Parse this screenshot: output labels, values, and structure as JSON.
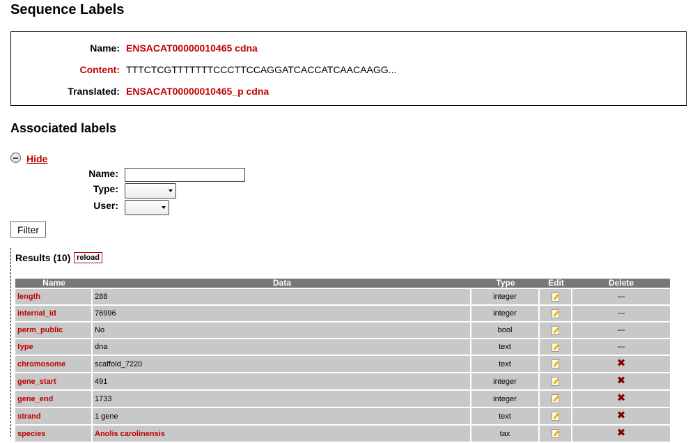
{
  "page_title": "Sequence Labels",
  "sequence": {
    "name_label": "Name:",
    "name_value": "ENSACAT00000010465 cdna",
    "content_label": "Content:",
    "content_value": "TTTCTCGTTTTTTTCCCTTCCAGGATCACCATCAACAAGG...",
    "translated_label": "Translated:",
    "translated_value": "ENSACAT00000010465_p cdna"
  },
  "associated_title": "Associated labels",
  "toggle_link": "Hide",
  "filter": {
    "name_label": "Name:",
    "name_value": "",
    "type_label": "Type:",
    "type_value": "",
    "user_label": "User:",
    "user_value": "",
    "button": "Filter"
  },
  "results": {
    "title": "Results (10)",
    "reload": "reload",
    "columns": [
      "Name",
      "Data",
      "Type",
      "Edit",
      "Delete"
    ],
    "rows": [
      {
        "name": "length",
        "data": "288",
        "type": "integer",
        "delete": "---",
        "data_style": "normal"
      },
      {
        "name": "internal_id",
        "data": "76996",
        "type": "integer",
        "delete": "---",
        "data_style": "normal"
      },
      {
        "name": "perm_public",
        "data": "No",
        "type": "bool",
        "delete": "---",
        "data_style": "normal"
      },
      {
        "name": "type",
        "data": "dna",
        "type": "text",
        "delete": "---",
        "data_style": "normal"
      },
      {
        "name": "chromosome",
        "data": "scaffold_7220",
        "type": "text",
        "delete": "x-icon",
        "data_style": "normal"
      },
      {
        "name": "gene_start",
        "data": "491",
        "type": "integer",
        "delete": "x-icon",
        "data_style": "normal"
      },
      {
        "name": "gene_end",
        "data": "1733",
        "type": "integer",
        "delete": "x-icon",
        "data_style": "normal"
      },
      {
        "name": "strand",
        "data": "1 gene",
        "type": "text",
        "delete": "x-icon",
        "data_style": "normal"
      },
      {
        "name": "species",
        "data": "Anolis carolinensis",
        "type": "tax",
        "delete": "x-icon",
        "data_style": "link"
      }
    ]
  },
  "colors": {
    "accent": "#c00000",
    "table_header": "#777777",
    "table_row": "#c8c8c8",
    "delete_icon": "#7a0000"
  }
}
